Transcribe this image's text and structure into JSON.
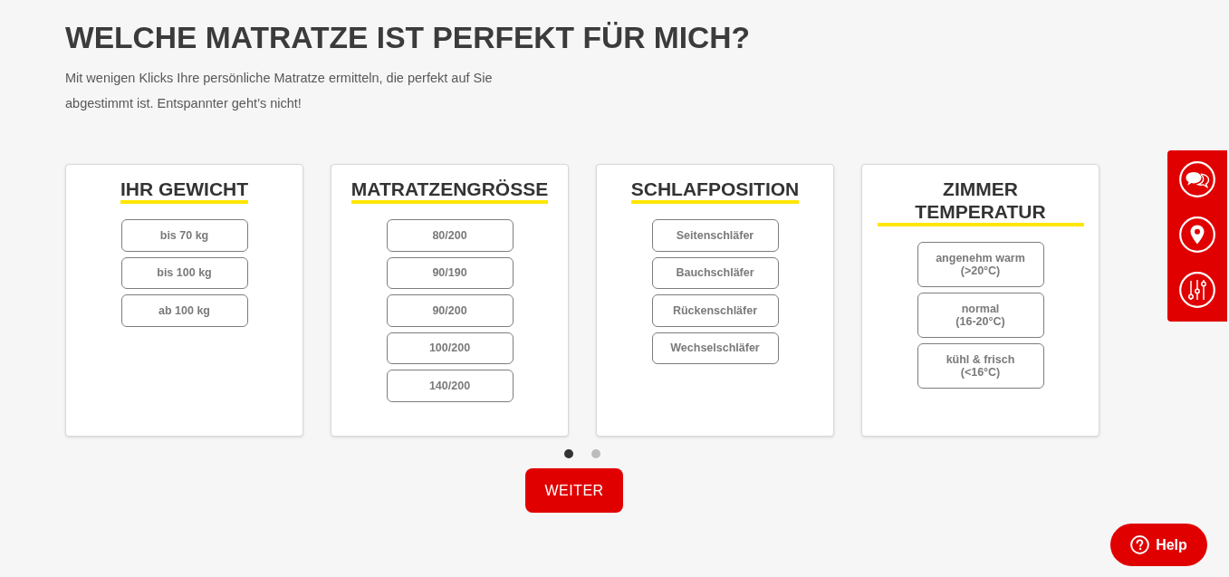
{
  "title": "WELCHE MATRATZE IST PERFEKT FÜR MICH?",
  "intro": "Mit wenigen Klicks Ihre persönliche Matratze ermitteln, die perfekt auf Sie abgestimmt ist. Entspannter geht’s nicht!",
  "cards": [
    {
      "heading": "IHR GEWICHT",
      "options": [
        {
          "label": "bis 70 kg",
          "selected": false
        },
        {
          "label": "bis 100 kg",
          "selected": false
        },
        {
          "label": "ab 100 kg",
          "selected": false
        }
      ]
    },
    {
      "heading": "MATRATZENGRÖSSE",
      "options": [
        {
          "label": "80/200",
          "selected": false
        },
        {
          "label": "90/190",
          "selected": false
        },
        {
          "label": "90/200",
          "selected": false
        },
        {
          "label": "100/200",
          "selected": false
        },
        {
          "label": "140/200",
          "selected": false
        }
      ]
    },
    {
      "heading": "SCHLAFPOSITION",
      "options": [
        {
          "label": "Seitenschläfer",
          "selected": false
        },
        {
          "label": "Bauchschläfer",
          "selected": false
        },
        {
          "label": "Rückenschläfer",
          "selected": false
        },
        {
          "label": "Wechselschläfer",
          "selected": false
        }
      ]
    },
    {
      "heading": "ZIMMER TEMPERATUR",
      "options": [
        {
          "label": "angenehm warm",
          "note": "(>20°C)",
          "selected": false
        },
        {
          "label": "normal",
          "note": "(16-20°C)",
          "selected": false
        },
        {
          "label": "kühl & frisch",
          "note": "(<16°C)",
          "selected": false
        }
      ]
    }
  ],
  "pager": [
    {
      "selected": true
    },
    {
      "selected": false
    }
  ],
  "next_button": "WEITER",
  "help_button": "Help"
}
